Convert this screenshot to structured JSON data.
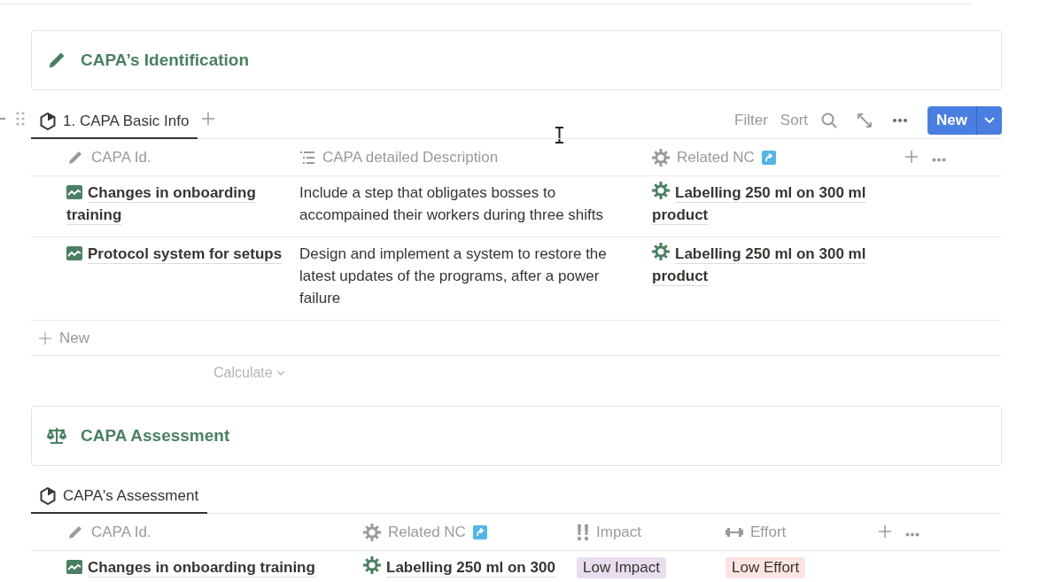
{
  "identification_callout": {
    "title": "CAPA’s Identification"
  },
  "basic_info_view": {
    "tabs": [
      {
        "label": "1. CAPA Basic Info",
        "selected": true
      }
    ],
    "toolbar": {
      "filter": "Filter",
      "sort": "Sort",
      "new_button": "New"
    },
    "columns": [
      {
        "name": "CAPA Id.",
        "kind": "title"
      },
      {
        "name": "CAPA detailed Description",
        "kind": "text"
      },
      {
        "name": "Related NC",
        "kind": "relation"
      }
    ],
    "rows": [
      {
        "cells": [
          "Changes in onboarding training",
          "Include a step that obligates bosses to accompained their workers during three shifts",
          "Labelling 250 ml on 300 ml product"
        ]
      },
      {
        "cells": [
          "Protocol system for setups",
          "Design and implement a system to restore the latest updates of the programs, after a power failure",
          "Labelling 250 ml on 300 ml product"
        ]
      }
    ],
    "new_row": "New",
    "calculate": "Calculate"
  },
  "assessment_callout": {
    "title": "CAPA Assessment"
  },
  "assessment_view": {
    "tabs": [
      {
        "label": "CAPA's Assessment",
        "selected": true
      }
    ],
    "columns": [
      {
        "name": "CAPA Id.",
        "kind": "title"
      },
      {
        "name": "Related NC",
        "kind": "relation"
      },
      {
        "name": "Impact",
        "kind": "priority"
      },
      {
        "name": "Effort",
        "kind": "effort"
      }
    ],
    "rows": [
      {
        "cells": [
          "Changes in onboarding training",
          "Labelling 250 ml on 300",
          {
            "text": "Low Impact",
            "color": "#e8deee"
          },
          {
            "text": "Low Effort",
            "color": "#fbe4e4"
          }
        ]
      }
    ]
  }
}
